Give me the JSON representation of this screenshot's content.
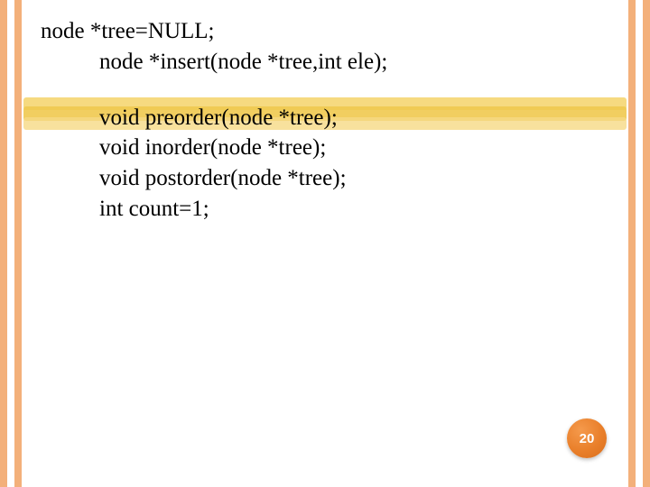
{
  "code": {
    "line1": "node *tree=NULL;",
    "line2": "node *insert(node *tree,int ele);",
    "line3": "void preorder(node *tree);",
    "line4": "void inorder(node *tree);",
    "line5": "void postorder(node *tree);",
    "line6": "int count=1;"
  },
  "page_number": "20"
}
